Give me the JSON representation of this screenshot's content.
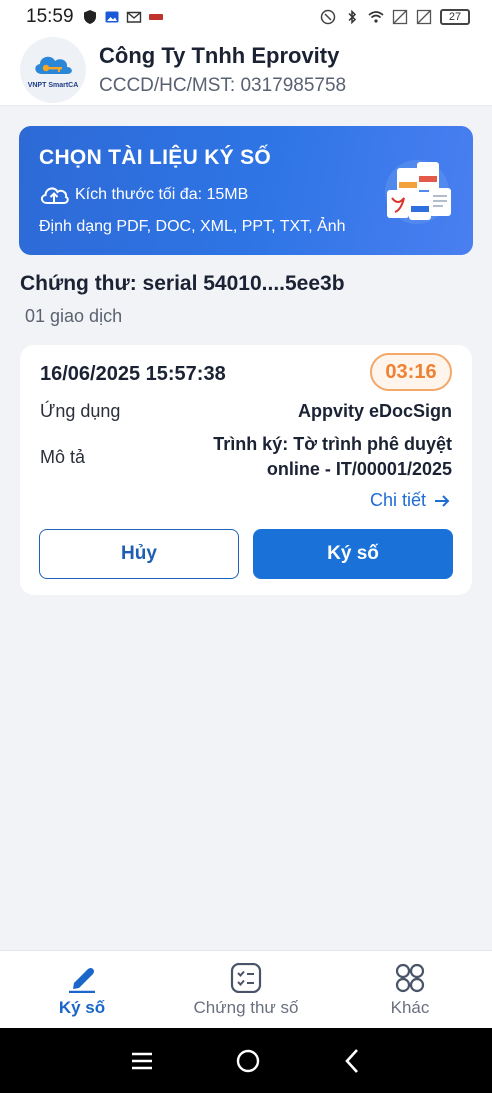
{
  "status_bar": {
    "time": "15:59",
    "battery": "27"
  },
  "header": {
    "company_name": "Công Ty Tnhh Eprovity",
    "tax_id": "CCCD/HC/MST: 0317985758",
    "logo_caption": "VNPT SmartCA"
  },
  "banner": {
    "title": "CHỌN TÀI LIỆU KÝ SỐ",
    "max_size": "Kích thước tối đa: 15MB",
    "formats": "Định dạng PDF, DOC, XML, PPT, TXT, Ảnh"
  },
  "certificate": {
    "title": "Chứng thư: serial 54010....5ee3b",
    "count": "01 giao dịch"
  },
  "transaction": {
    "datetime": "16/06/2025 15:57:38",
    "timer": "03:16",
    "app_label": "Ứng dụng",
    "app_value": "Appvity eDocSign",
    "desc_label": "Mô tả",
    "desc_value_line1": "Trình ký: Tờ trình phê duyệt",
    "desc_value_line2": "online - IT/00001/2025",
    "detail_link": "Chi tiết",
    "cancel_label": "Hủy",
    "sign_label": "Ký số"
  },
  "bottom_nav": {
    "items": [
      {
        "label": "Ký số",
        "icon": "pen-icon",
        "active": true
      },
      {
        "label": "Chứng thư số",
        "icon": "checklist-icon",
        "active": false
      },
      {
        "label": "Khác",
        "icon": "grid-icon",
        "active": false
      }
    ]
  },
  "colors": {
    "primary": "#1a72d8",
    "timer_orange": "#ee8132",
    "banner_blue": "#2f75e6"
  }
}
